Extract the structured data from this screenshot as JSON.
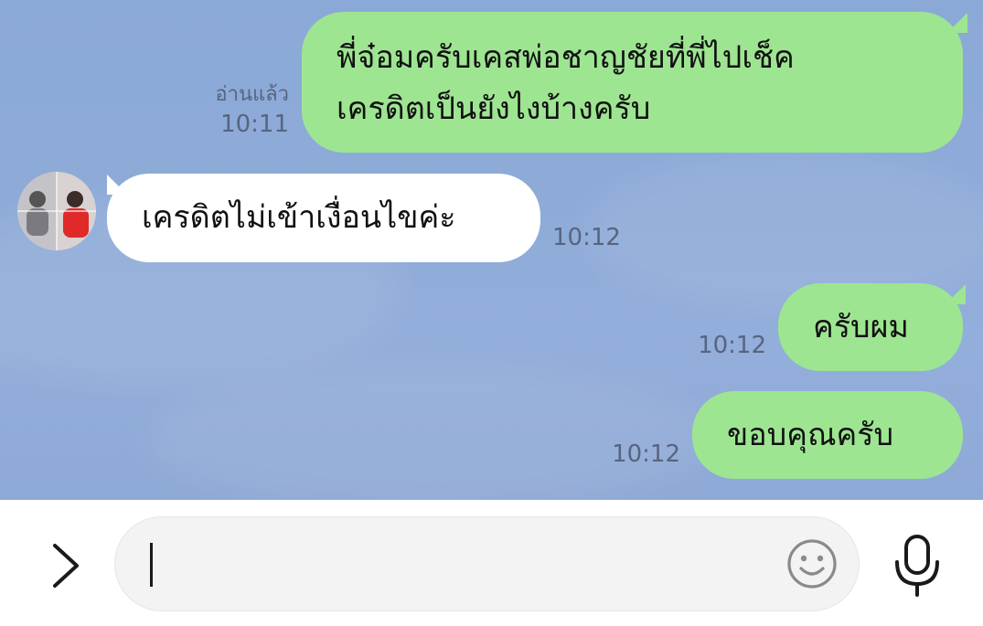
{
  "messages": [
    {
      "direction": "outgoing",
      "lines": [
        "พี่จ๋อมครับเคสพ่อชาญชัยที่พี่ไปเช็ค",
        "เครดิตเป็นยังไงบ้างครับ"
      ],
      "read_label": "อ่านแล้ว",
      "time": "10:11"
    },
    {
      "direction": "incoming",
      "text": "เครดิตไม่เข้าเงื่อนไขค่ะ",
      "time": "10:12"
    },
    {
      "direction": "outgoing",
      "text": "ครับผม",
      "time": "10:12"
    },
    {
      "direction": "outgoing",
      "text": "ขอบคุณครับ",
      "time": "10:12"
    }
  ],
  "composer": {
    "input_value": "",
    "icons": [
      "chevron-right-icon",
      "emoji-smiley-icon",
      "microphone-icon"
    ]
  },
  "colors": {
    "chat_background": "#8ba9d7",
    "outgoing_bubble": "#9ee592",
    "incoming_bubble": "#ffffff",
    "timestamp_text": "#56657f"
  }
}
